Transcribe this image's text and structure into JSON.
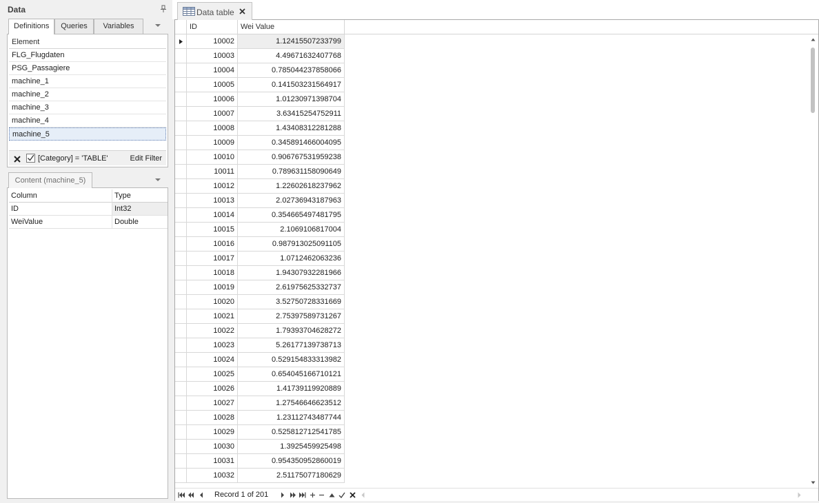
{
  "panel": {
    "title": "Data",
    "tabs": [
      "Definitions",
      "Queries",
      "Variables"
    ],
    "elements_header": "Element",
    "elements": [
      "FLG_Flugdaten",
      "PSG_Passagiere",
      "machine_1",
      "machine_2",
      "machine_3",
      "machine_4",
      "machine_5"
    ],
    "selected_element": "machine_5",
    "filter_text": "[Category] = 'TABLE'",
    "filter_checked": true,
    "edit_filter_label": "Edit Filter",
    "content_tab": "Content (machine_5)",
    "columns_header": {
      "column": "Column",
      "type": "Type"
    },
    "columns": [
      {
        "name": "ID",
        "type": "Int32"
      },
      {
        "name": "WeiValue",
        "type": "Double"
      }
    ]
  },
  "document": {
    "tab_title": "Data table",
    "grid": {
      "headers": {
        "id": "ID",
        "value": "Wei Value"
      },
      "rows": [
        {
          "id": "10002",
          "value": "1.12415507233799"
        },
        {
          "id": "10003",
          "value": "4.49671632407768"
        },
        {
          "id": "10004",
          "value": "0.785044237858066"
        },
        {
          "id": "10005",
          "value": "0.141503231564917"
        },
        {
          "id": "10006",
          "value": "1.01230971398704"
        },
        {
          "id": "10007",
          "value": "3.63415254752911"
        },
        {
          "id": "10008",
          "value": "1.43408312281288"
        },
        {
          "id": "10009",
          "value": "0.345891466004095"
        },
        {
          "id": "10010",
          "value": "0.906767531959238"
        },
        {
          "id": "10011",
          "value": "0.789631158090649"
        },
        {
          "id": "10012",
          "value": "1.22602618237962"
        },
        {
          "id": "10013",
          "value": "2.02736943187963"
        },
        {
          "id": "10014",
          "value": "0.354665497481795"
        },
        {
          "id": "10015",
          "value": "2.1069106817004"
        },
        {
          "id": "10016",
          "value": "0.987913025091105"
        },
        {
          "id": "10017",
          "value": "1.0712462063236"
        },
        {
          "id": "10018",
          "value": "1.94307932281966"
        },
        {
          "id": "10019",
          "value": "2.61975625332737"
        },
        {
          "id": "10020",
          "value": "3.52750728331669"
        },
        {
          "id": "10021",
          "value": "2.75397589731267"
        },
        {
          "id": "10022",
          "value": "1.79393704628272"
        },
        {
          "id": "10023",
          "value": "5.26177139738713"
        },
        {
          "id": "10024",
          "value": "0.529154833313982"
        },
        {
          "id": "10025",
          "value": "0.654045166710121"
        },
        {
          "id": "10026",
          "value": "1.41739119920889"
        },
        {
          "id": "10027",
          "value": "1.27546646623512"
        },
        {
          "id": "10028",
          "value": "1.23112743487744"
        },
        {
          "id": "10029",
          "value": "0.525812712541785"
        },
        {
          "id": "10030",
          "value": "1.3925459925498"
        },
        {
          "id": "10031",
          "value": "0.954350952860019"
        },
        {
          "id": "10032",
          "value": "2.51175077180629"
        }
      ],
      "focused_row": 0
    },
    "navigator": {
      "record_label": "Record 1 of 201"
    }
  },
  "colors": {
    "selection": "#e6eef8",
    "border": "#b9b9b9",
    "icon": "#555555"
  }
}
